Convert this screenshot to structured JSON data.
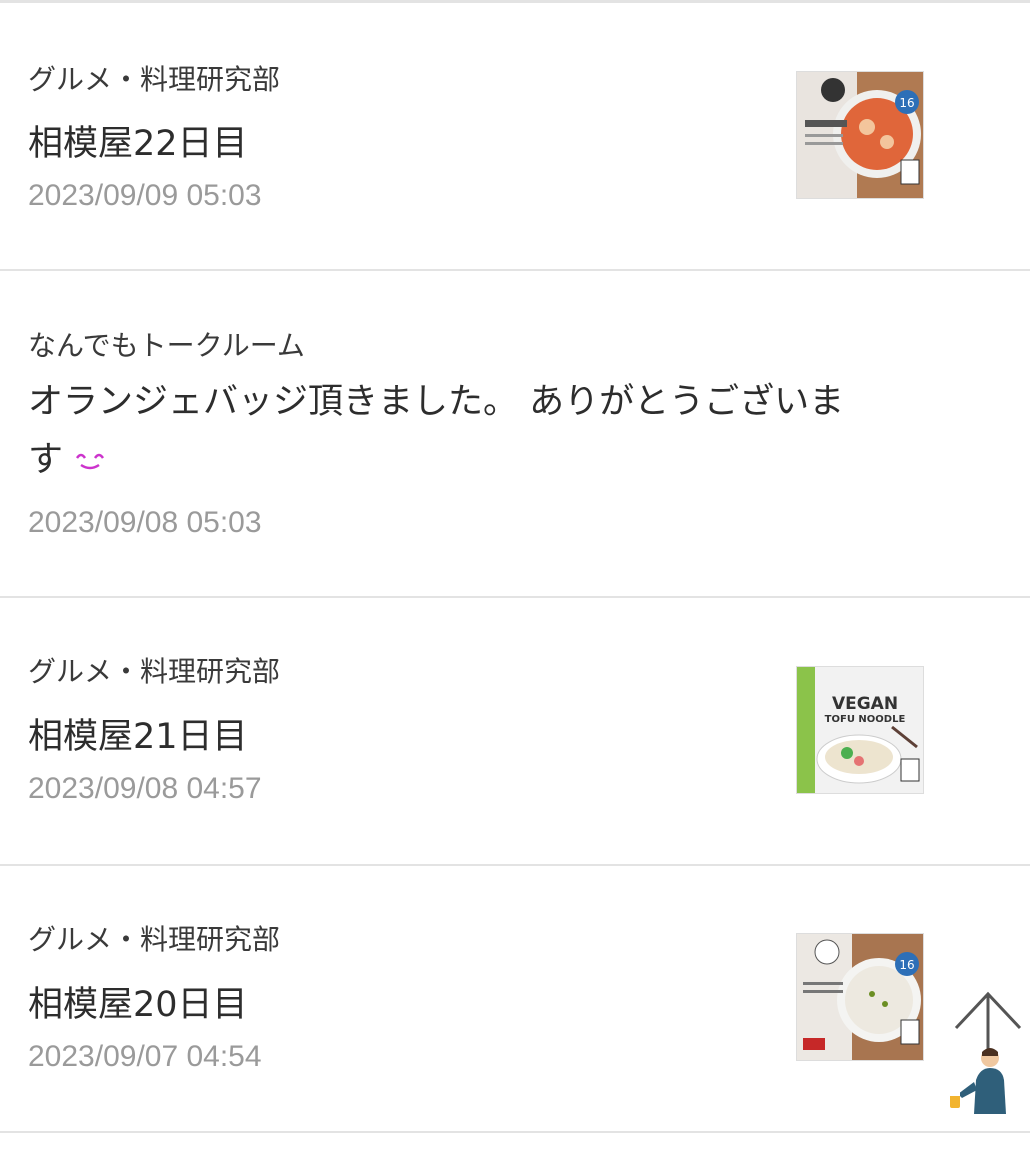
{
  "posts": [
    {
      "community": "グルメ・料理研究部",
      "title": "相模屋22日目",
      "date": "2023/09/09 05:03",
      "thumb_badge": "16"
    },
    {
      "community": "なんでもトークルーム",
      "title_line1": "オランジェバッジ頂きました。 ありがとうございま",
      "title_line2": "す",
      "date": "2023/09/08 05:03"
    },
    {
      "community": "グルメ・料理研究部",
      "title": "相模屋21日目",
      "date": "2023/09/08 04:57",
      "thumb_text1": "VEGAN",
      "thumb_text2": "TOFU NOODLE"
    },
    {
      "community": "グルメ・料理研究部",
      "title": "相模屋20日目",
      "date": "2023/09/07 04:54",
      "thumb_badge": "16"
    }
  ],
  "colors": {
    "divider": "#e3e3e3",
    "date": "#9a9a9a",
    "emoji": "#cc33cc"
  },
  "icons": {
    "emoji": "smile-emoji-icon",
    "scroll_top": "scroll-to-top-icon"
  }
}
